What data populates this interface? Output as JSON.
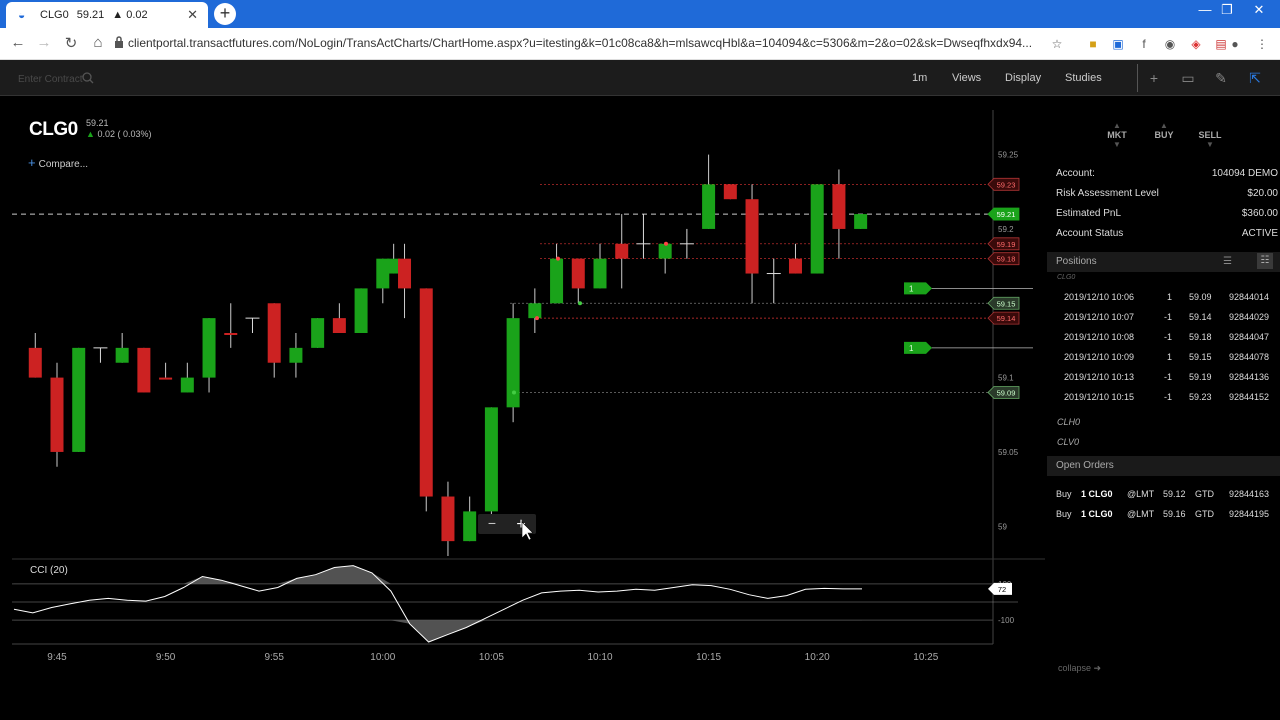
{
  "browser": {
    "tab_title": "CLG0",
    "tab_price": "59.21",
    "tab_change": "▲ 0.02",
    "url": "clientportal.transactfutures.com/NoLogin/TransActCharts/ChartHome.aspx?u=itesting&k=01c08ca8&h=mlsawcqHbl&a=104094&c=5306&m=2&o=02&sk=Dwseqfhxdx94..."
  },
  "toolbar": {
    "contract_placeholder": "Enter Contract",
    "interval": "1m",
    "views": "Views",
    "display": "Display",
    "studies": "Studies"
  },
  "instrument": {
    "symbol": "CLG0",
    "price": "59.21",
    "change": "0.02 ( 0.03%)",
    "compare_label": "Compare..."
  },
  "chart_data": {
    "type": "candlestick",
    "x_ticks": [
      "9:45",
      "9:50",
      "9:55",
      "10:00",
      "10:05",
      "10:10",
      "10:15",
      "10:20",
      "10:25"
    ],
    "y_ticks": [
      "59.25",
      "59.2",
      "59.15",
      "59.1",
      "59.05",
      "59"
    ],
    "ylim": [
      58.98,
      59.28
    ],
    "grid": false,
    "last_price": "59.21",
    "price_tags": [
      {
        "label": "59.23",
        "kind": "sell"
      },
      {
        "label": "59.21",
        "kind": "last"
      },
      {
        "label": "59.19",
        "kind": "sell"
      },
      {
        "label": "59.18",
        "kind": "sell"
      },
      {
        "label": "59.15",
        "kind": "fill"
      },
      {
        "label": "59.14",
        "kind": "sell"
      },
      {
        "label": "59.09",
        "kind": "fill"
      }
    ],
    "order_markers": [
      {
        "qty": "1",
        "price": 59.16
      },
      {
        "qty": "1",
        "price": 59.12
      }
    ],
    "candles": [
      {
        "t": "9:44",
        "o": 59.12,
        "h": 59.13,
        "l": 59.1,
        "c": 59.1,
        "dir": "down"
      },
      {
        "t": "9:45",
        "o": 59.1,
        "h": 59.11,
        "l": 59.04,
        "c": 59.05,
        "dir": "down"
      },
      {
        "t": "9:46",
        "o": 59.05,
        "h": 59.12,
        "l": 59.05,
        "c": 59.12,
        "dir": "up"
      },
      {
        "t": "9:47",
        "o": 59.12,
        "h": 59.12,
        "l": 59.11,
        "c": 59.11,
        "dir": "flat"
      },
      {
        "t": "9:48",
        "o": 59.11,
        "h": 59.13,
        "l": 59.11,
        "c": 59.12,
        "dir": "up"
      },
      {
        "t": "9:49",
        "o": 59.12,
        "h": 59.12,
        "l": 59.09,
        "c": 59.09,
        "dir": "down"
      },
      {
        "t": "9:50",
        "o": 59.1,
        "h": 59.11,
        "l": 59.1,
        "c": 59.1,
        "dir": "down"
      },
      {
        "t": "9:51",
        "o": 59.09,
        "h": 59.11,
        "l": 59.09,
        "c": 59.1,
        "dir": "up"
      },
      {
        "t": "9:52",
        "o": 59.1,
        "h": 59.14,
        "l": 59.09,
        "c": 59.14,
        "dir": "up"
      },
      {
        "t": "9:53",
        "o": 59.13,
        "h": 59.15,
        "l": 59.12,
        "c": 59.13,
        "dir": "down"
      },
      {
        "t": "9:54",
        "o": 59.14,
        "h": 59.14,
        "l": 59.13,
        "c": 59.14,
        "dir": "flat"
      },
      {
        "t": "9:55",
        "o": 59.15,
        "h": 59.15,
        "l": 59.1,
        "c": 59.11,
        "dir": "down"
      },
      {
        "t": "9:56",
        "o": 59.11,
        "h": 59.13,
        "l": 59.1,
        "c": 59.12,
        "dir": "up"
      },
      {
        "t": "9:57",
        "o": 59.12,
        "h": 59.14,
        "l": 59.12,
        "c": 59.14,
        "dir": "up"
      },
      {
        "t": "9:58",
        "o": 59.14,
        "h": 59.15,
        "l": 59.13,
        "c": 59.13,
        "dir": "down"
      },
      {
        "t": "9:59",
        "o": 59.13,
        "h": 59.16,
        "l": 59.13,
        "c": 59.16,
        "dir": "up"
      },
      {
        "t": "10:00",
        "o": 59.16,
        "h": 59.18,
        "l": 59.15,
        "c": 59.18,
        "dir": "up"
      },
      {
        "t": "10:00b",
        "o": 59.18,
        "h": 59.19,
        "l": 59.17,
        "c": 59.17,
        "dir": "up"
      },
      {
        "t": "10:01",
        "o": 59.18,
        "h": 59.19,
        "l": 59.14,
        "c": 59.16,
        "dir": "down"
      },
      {
        "t": "10:02",
        "o": 59.16,
        "h": 59.16,
        "l": 59.01,
        "c": 59.02,
        "dir": "down"
      },
      {
        "t": "10:03",
        "o": 59.02,
        "h": 59.03,
        "l": 58.98,
        "c": 58.99,
        "dir": "down"
      },
      {
        "t": "10:04",
        "o": 58.99,
        "h": 59.02,
        "l": 58.99,
        "c": 59.01,
        "dir": "up"
      },
      {
        "t": "10:05",
        "o": 59.01,
        "h": 59.08,
        "l": 59.0,
        "c": 59.08,
        "dir": "up"
      },
      {
        "t": "10:06",
        "o": 59.08,
        "h": 59.15,
        "l": 59.07,
        "c": 59.14,
        "dir": "up"
      },
      {
        "t": "10:07",
        "o": 59.14,
        "h": 59.16,
        "l": 59.13,
        "c": 59.15,
        "dir": "up"
      },
      {
        "t": "10:08",
        "o": 59.15,
        "h": 59.19,
        "l": 59.15,
        "c": 59.18,
        "dir": "up"
      },
      {
        "t": "10:09",
        "o": 59.18,
        "h": 59.18,
        "l": 59.15,
        "c": 59.16,
        "dir": "down"
      },
      {
        "t": "10:10",
        "o": 59.16,
        "h": 59.19,
        "l": 59.16,
        "c": 59.18,
        "dir": "up"
      },
      {
        "t": "10:11",
        "o": 59.19,
        "h": 59.21,
        "l": 59.16,
        "c": 59.18,
        "dir": "down"
      },
      {
        "t": "10:12",
        "o": 59.19,
        "h": 59.21,
        "l": 59.18,
        "c": 59.19,
        "dir": "flat"
      },
      {
        "t": "10:13",
        "o": 59.18,
        "h": 59.19,
        "l": 59.17,
        "c": 59.19,
        "dir": "up"
      },
      {
        "t": "10:14",
        "o": 59.19,
        "h": 59.2,
        "l": 59.18,
        "c": 59.19,
        "dir": "flat"
      },
      {
        "t": "10:15",
        "o": 59.2,
        "h": 59.25,
        "l": 59.2,
        "c": 59.23,
        "dir": "up"
      },
      {
        "t": "10:16",
        "o": 59.23,
        "h": 59.23,
        "l": 59.22,
        "c": 59.22,
        "dir": "down"
      },
      {
        "t": "10:17",
        "o": 59.22,
        "h": 59.23,
        "l": 59.15,
        "c": 59.17,
        "dir": "down"
      },
      {
        "t": "10:18",
        "o": 59.17,
        "h": 59.18,
        "l": 59.15,
        "c": 59.17,
        "dir": "flat"
      },
      {
        "t": "10:19",
        "o": 59.18,
        "h": 59.19,
        "l": 59.17,
        "c": 59.17,
        "dir": "down"
      },
      {
        "t": "10:20",
        "o": 59.17,
        "h": 59.23,
        "l": 59.17,
        "c": 59.23,
        "dir": "up"
      },
      {
        "t": "10:21",
        "o": 59.23,
        "h": 59.24,
        "l": 59.18,
        "c": 59.2,
        "dir": "down"
      },
      {
        "t": "10:22",
        "o": 59.2,
        "h": 59.21,
        "l": 59.2,
        "c": 59.21,
        "dir": "up"
      }
    ],
    "cci": {
      "label": "CCI (20)",
      "y_ticks": [
        "100",
        "-100"
      ],
      "current": "72",
      "ylim": [
        -220,
        220
      ],
      "values": [
        -40,
        -60,
        -30,
        -10,
        10,
        20,
        10,
        5,
        30,
        80,
        140,
        120,
        90,
        60,
        80,
        130,
        150,
        190,
        200,
        160,
        60,
        -120,
        -220,
        -180,
        -140,
        -90,
        -40,
        10,
        50,
        60,
        65,
        55,
        60,
        70,
        65,
        80,
        95,
        90,
        70,
        40,
        20,
        35,
        70,
        75,
        72,
        72
      ]
    }
  },
  "zoom": {
    "minus": "−",
    "plus": "+"
  },
  "trade_buttons": {
    "mkt": "MKT",
    "buy": "BUY",
    "sell": "SELL"
  },
  "account": [
    {
      "k": "Account:",
      "v": "104094  DEMO"
    },
    {
      "k": "Risk Assessment Level",
      "v": "$20.00"
    },
    {
      "k": "Estimated PnL",
      "v": "$360.00"
    },
    {
      "k": "Account Status",
      "v": "ACTIVE"
    }
  ],
  "positions": {
    "header": "Positions",
    "group": "CLG0",
    "rows": [
      {
        "time": "2019/12/10 10:06",
        "qty": "1",
        "price": "59.09",
        "id": "92844014"
      },
      {
        "time": "2019/12/10 10:07",
        "qty": "-1",
        "price": "59.14",
        "id": "92844029"
      },
      {
        "time": "2019/12/10 10:08",
        "qty": "-1",
        "price": "59.18",
        "id": "92844047"
      },
      {
        "time": "2019/12/10 10:09",
        "qty": "1",
        "price": "59.15",
        "id": "92844078"
      },
      {
        "time": "2019/12/10 10:13",
        "qty": "-1",
        "price": "59.19",
        "id": "92844136"
      },
      {
        "time": "2019/12/10 10:15",
        "qty": "-1",
        "price": "59.23",
        "id": "92844152"
      }
    ],
    "sub1": "CLH0",
    "sub2": "CLV0"
  },
  "open_orders": {
    "header": "Open Orders",
    "rows": [
      {
        "side": "Buy",
        "qty_sym": "1 CLG0",
        "type": "@LMT",
        "price": "59.12",
        "tif": "GTD",
        "id": "92844163"
      },
      {
        "side": "Buy",
        "qty_sym": "1 CLG0",
        "type": "@LMT",
        "price": "59.16",
        "tif": "GTD",
        "id": "92844195"
      }
    ]
  },
  "collapse_label": "collapse",
  "colors": {
    "up": "#1aa31a",
    "down": "#cc2222",
    "bg": "#000000",
    "tab_blue": "#1f6ad8"
  }
}
